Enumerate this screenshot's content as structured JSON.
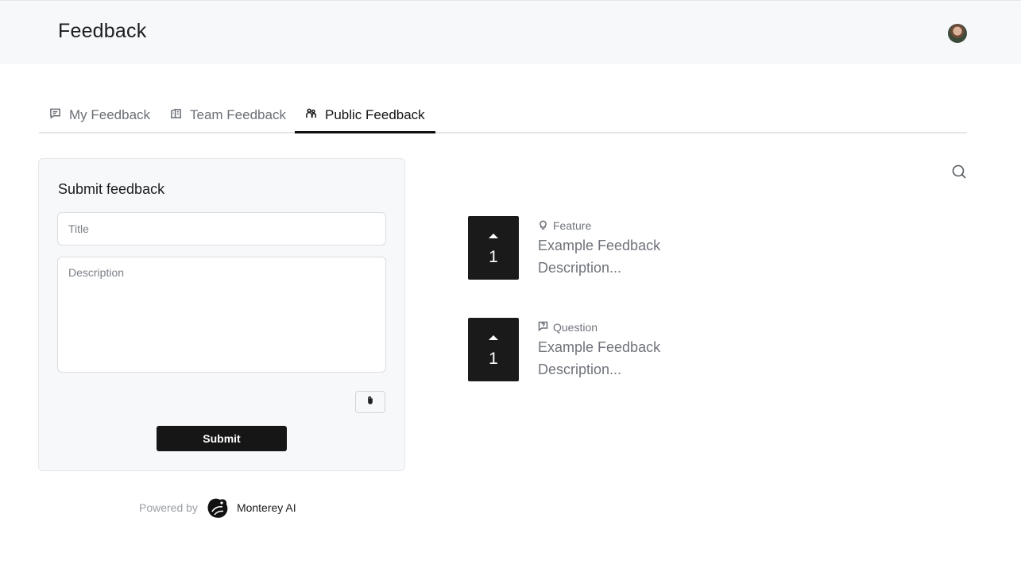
{
  "header": {
    "title": "Feedback",
    "avatar_icon": "user-avatar"
  },
  "tabs": [
    {
      "label": "My Feedback",
      "icon": "message-square-icon",
      "active": false
    },
    {
      "label": "Team Feedback",
      "icon": "building-icon",
      "active": false
    },
    {
      "label": "Public Feedback",
      "icon": "users-icon",
      "active": true
    }
  ],
  "form": {
    "heading": "Submit feedback",
    "title_placeholder": "Title",
    "title_value": "",
    "description_placeholder": "Description",
    "description_value": "",
    "attach_icon": "paperclip-icon",
    "submit_label": "Submit"
  },
  "footer": {
    "powered_by": "Powered by",
    "brand_name": "Monterey AI"
  },
  "search_icon": "search-icon",
  "feedback_items": [
    {
      "votes": "1",
      "type": "Feature",
      "type_icon": "lightbulb-icon",
      "title": "Example Feedback",
      "description": "Description..."
    },
    {
      "votes": "1",
      "type": "Question",
      "type_icon": "message-question-icon",
      "title": "Example Feedback",
      "description": "Description..."
    }
  ],
  "colors": {
    "accent": "#161616",
    "header_bg": "#f7f8fa",
    "muted_text": "#6f737a"
  }
}
